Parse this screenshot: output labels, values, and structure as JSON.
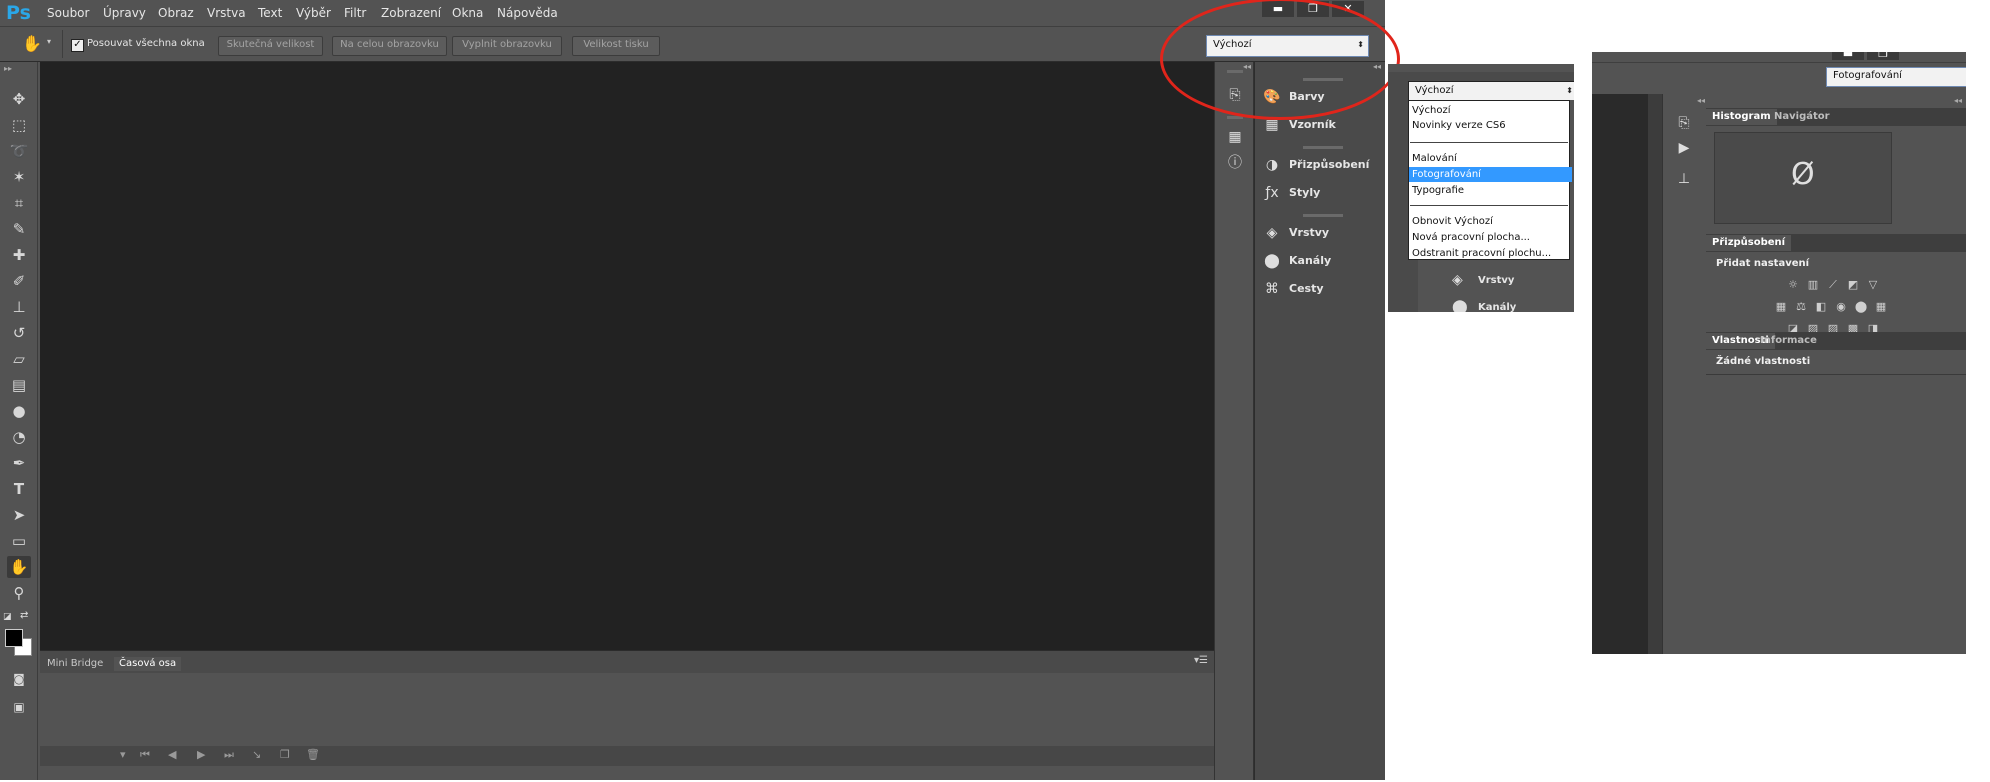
{
  "app": {
    "logo": "Ps",
    "menu": [
      "Soubor",
      "Úpravy",
      "Obraz",
      "Vrstva",
      "Text",
      "Výběr",
      "Filtr",
      "Zobrazení",
      "Okna",
      "Nápověda"
    ],
    "window_controls": [
      "minimize-icon",
      "restore-icon",
      "close-icon"
    ]
  },
  "options_bar": {
    "checkbox_label": "Posouvat všechna okna",
    "checkbox_checked": true,
    "buttons": [
      "Skutečná velikost",
      "Na celou obrazovku",
      "Vyplnit obrazovku",
      "Velikost tisku"
    ],
    "workspace_value": "Výchozí"
  },
  "bottom_panel": {
    "tabs": [
      "Mini Bridge",
      "Časová osa"
    ],
    "active_tab": "Časová osa"
  },
  "dock": {
    "items": [
      "Barvy",
      "Vzorník",
      "Přizpůsobení",
      "Styly",
      "Vrstvy",
      "Kanály",
      "Cesty"
    ]
  },
  "workspace_dropdown": {
    "current": "Výchozí",
    "options_group1": [
      "Výchozí",
      "Novinky verze CS6"
    ],
    "options_group2": [
      "Malování",
      "Fotografování",
      "Typografie"
    ],
    "options_group3": [
      "Obnovit Výchozí",
      "Nová pracovní plocha...",
      "Odstranit pracovní plochu..."
    ],
    "selected": "Fotografování",
    "below_items": [
      "Vrstvy",
      "Kanály"
    ]
  },
  "photography_workspace": {
    "workspace_value": "Fotografování",
    "panel1_tabs": [
      "Histogram",
      "Navigátor"
    ],
    "histogram_symbol": "Ø",
    "panel2_tab": "Přizpůsobení",
    "add_adjustment_label": "Přidat nastavení",
    "panel3_tabs": [
      "Vlastnosti",
      "Informace"
    ],
    "no_properties": "Žádné vlastnosti"
  },
  "colors": {
    "accent_ps": "#2aa7e8",
    "annotation_red": "#e0251b",
    "dropdown_selection": "#3399ff"
  }
}
